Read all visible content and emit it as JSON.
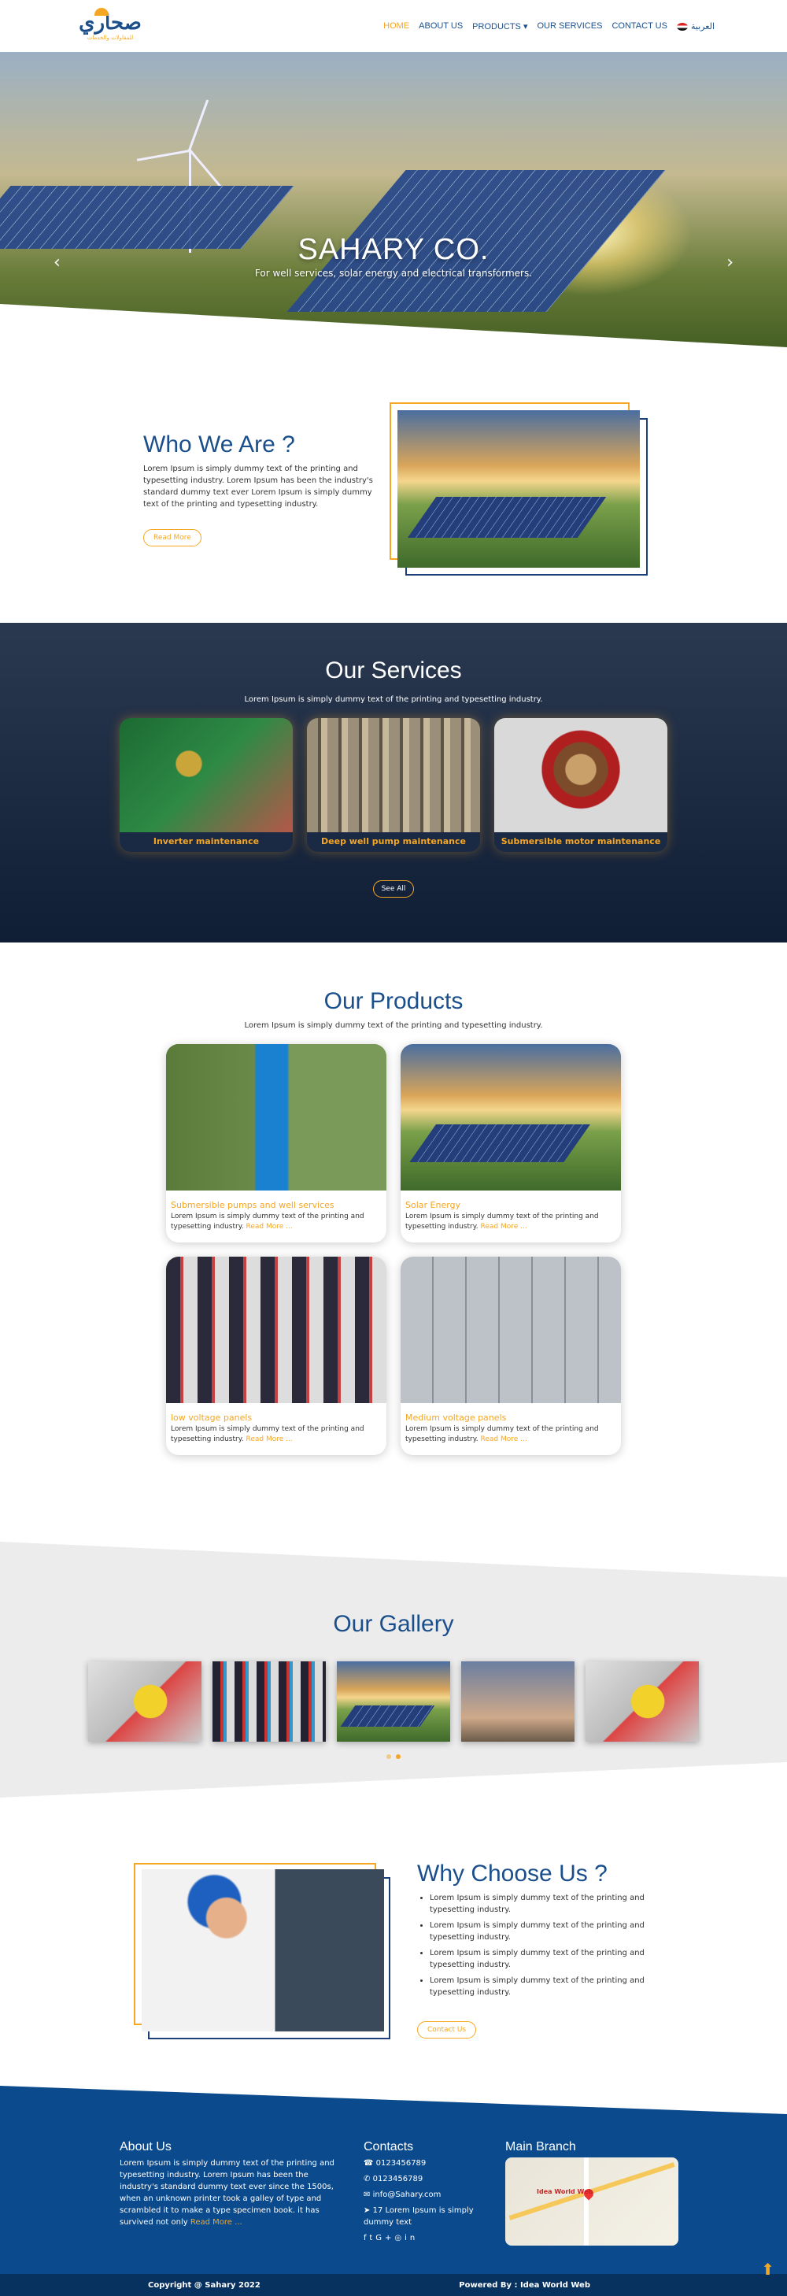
{
  "header": {
    "logo_text": "صحاري",
    "logo_sub": "للمقاولات والخدمات",
    "nav": [
      "HOME",
      "ABOUT US",
      "PRODUCTS",
      "OUR SERVICES",
      "CONTACT US"
    ],
    "products_caret": "▾",
    "lang": "العربية"
  },
  "hero": {
    "title": "SAHARY CO.",
    "subtitle": "For well services, solar energy and electrical transformers.",
    "prev": "‹",
    "next": "›"
  },
  "about": {
    "title": "Who We Are ?",
    "text": "Lorem Ipsum is simply dummy text of the printing and typesetting industry. Lorem Ipsum has been the industry's standard dummy text ever Lorem Ipsum is simply dummy text of the printing and typesetting industry.",
    "button": "Read More"
  },
  "services": {
    "title": "Our Services",
    "subtitle": "Lorem Ipsum is simply dummy text of the printing and typesetting industry.",
    "items": [
      "Inverter maintenance",
      "Deep well pump maintenance",
      "Submersible motor maintenance"
    ],
    "button": "See All"
  },
  "products": {
    "title": "Our Products",
    "subtitle": "Lorem Ipsum is simply dummy text of the printing and typesetting industry.",
    "items": [
      {
        "title": "Submersible pumps and well services",
        "text": "Lorem Ipsum is simply dummy text of the printing and typesetting industry.",
        "more": "Read More ..."
      },
      {
        "title": "Solar Energy",
        "text": "Lorem Ipsum is simply dummy text of the printing and typesetting industry.",
        "more": "Read More ..."
      },
      {
        "title": "low voltage panels",
        "text": "Lorem Ipsum is simply dummy text of the printing and typesetting industry.",
        "more": "Read More ..."
      },
      {
        "title": "Medium voltage panels",
        "text": "Lorem Ipsum is simply dummy text of the printing and typesetting industry.",
        "more": "Read More ..."
      }
    ]
  },
  "gallery": {
    "title": "Our Gallery"
  },
  "why": {
    "title": "Why Choose Us ?",
    "items": [
      "Lorem Ipsum is simply dummy text of the printing and typesetting industry.",
      "Lorem Ipsum is simply dummy text of the printing and typesetting industry.",
      "Lorem Ipsum is simply dummy text of the printing and typesetting industry.",
      "Lorem Ipsum is simply dummy text of the printing and typesetting industry."
    ],
    "button": "Contact Us"
  },
  "footer": {
    "about_title": "About Us",
    "about_text": "Lorem Ipsum is simply dummy text of the printing and typesetting industry. Lorem Ipsum has been the industry's standard dummy text ever since the 1500s, when an unknown printer took a galley of type and scrambled it to make a type specimen book. it has survived not only",
    "about_more": "Read More ...",
    "contacts_title": "Contacts",
    "phone": "0123456789",
    "whatsapp": "0123456789",
    "email": "info@Sahary.com",
    "address": "17 Lorem Ipsum is simply dummy text",
    "branch_title": "Main Branch",
    "map_label": "Idea World Web",
    "copyright": "Copyright @ Sahary 2022",
    "powered": "Powered By : Idea World Web"
  },
  "colors": {
    "primary": "#1b4f8c",
    "accent": "#f5a623",
    "footer": "#0b4a8c",
    "dark": "#101e35"
  }
}
